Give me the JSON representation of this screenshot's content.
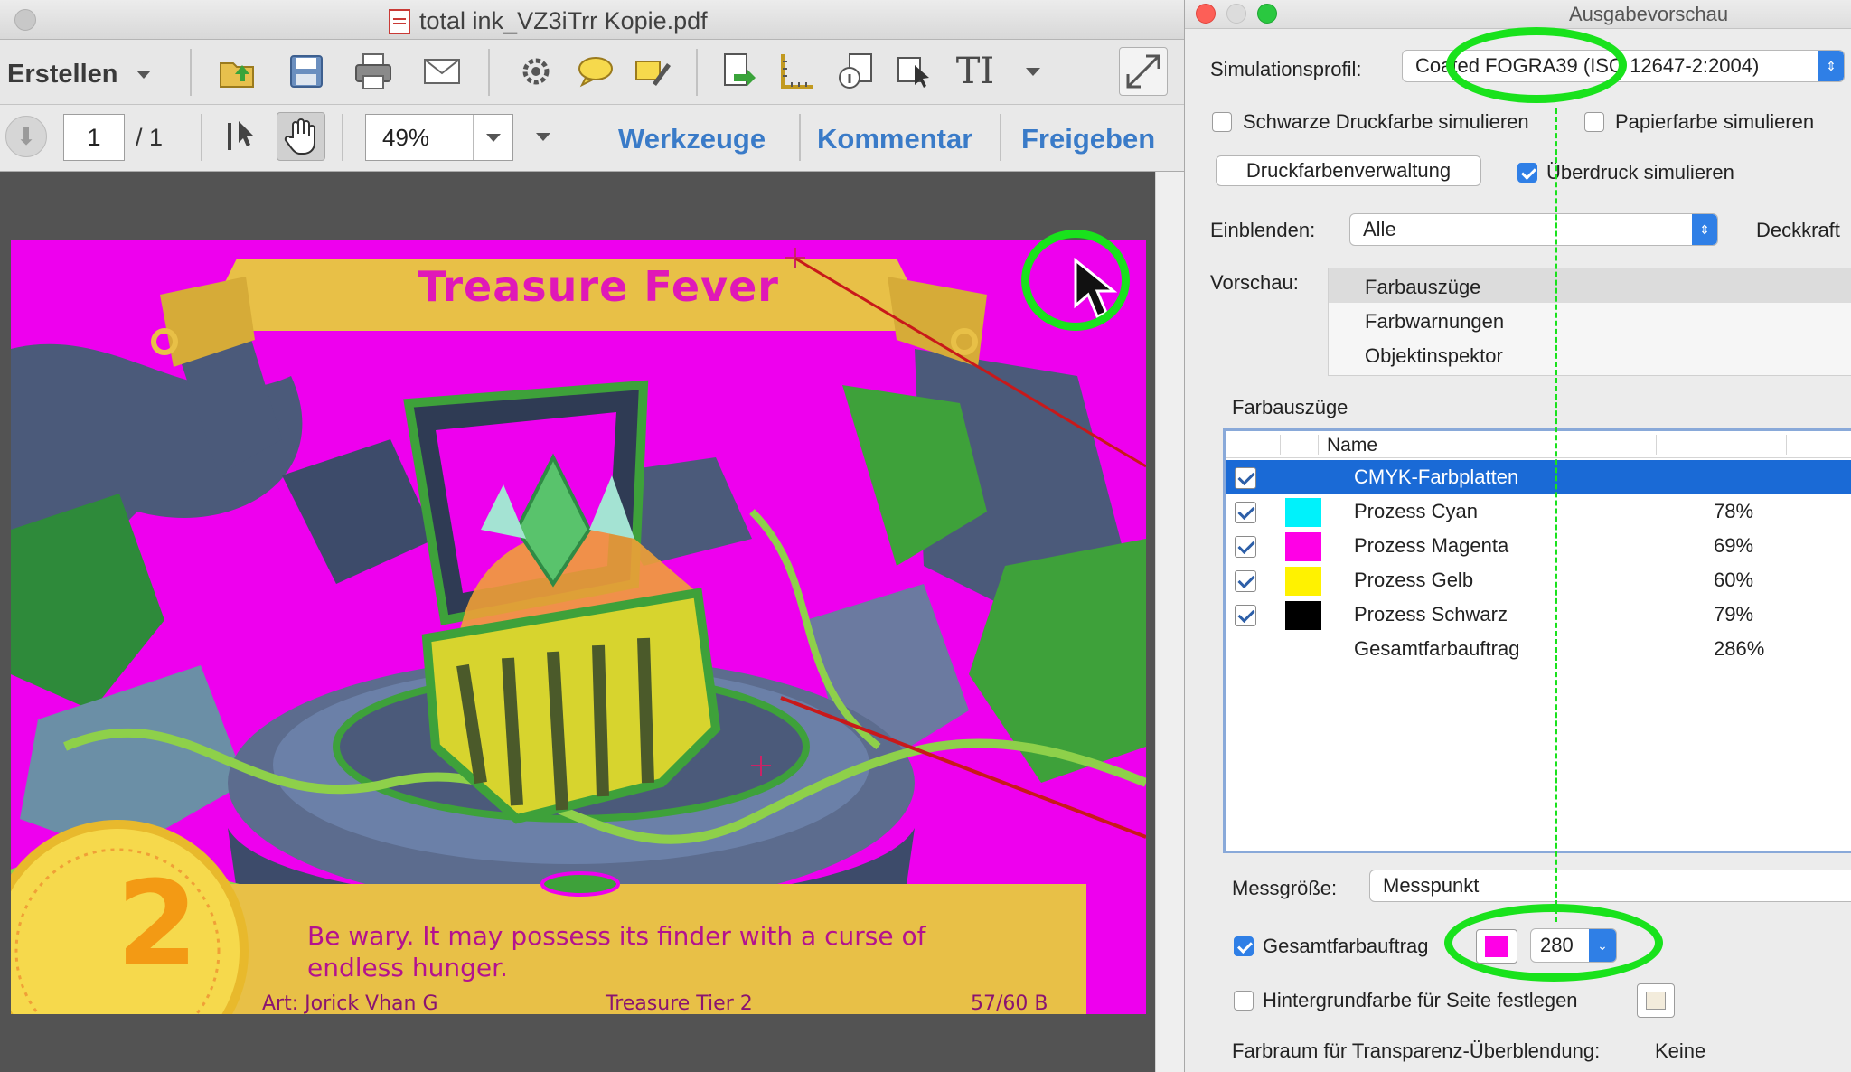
{
  "acrobat": {
    "window_title": "total ink_VZ3iTrr Kopie.pdf",
    "toolbar": {
      "create_label": "Erstellen",
      "icons": [
        "open-icon",
        "save-icon",
        "print-icon",
        "email-icon",
        "settings-icon",
        "comment-icon",
        "highlight-icon",
        "export-icon",
        "measure-icon",
        "info-icon",
        "select-icon",
        "text-tool-icon",
        "more-icon",
        "fullscreen-icon"
      ]
    },
    "nav": {
      "page_current": "1",
      "page_total": "/ 1",
      "zoom": "49%",
      "tools_label": "Werkzeuge",
      "comment_label": "Kommentar",
      "share_label": "Freigeben"
    },
    "card": {
      "title": "Treasure Fever",
      "coin_value": "2",
      "flavor_text": "Be wary. It may possess its finder with a curse of endless hunger.",
      "artist": "Art: Jorick Vhan G",
      "tier": "Treasure Tier 2",
      "number": "57/60 B",
      "colors": {
        "magenta": "#ee00ee",
        "gold": "#e8c047",
        "green": "#3ea13a",
        "slate": "#4b5a7a"
      }
    }
  },
  "preview": {
    "window_title": "Ausgabevorschau",
    "simulation_label": "Simulationsprofil:",
    "simulation_value": "Coated FOGRA39 (ISO 12647-2:2004)",
    "simulate_black_label": "Schwarze Druckfarbe simulieren",
    "simulate_paper_label": "Papierfarbe simulieren",
    "ink_manager_label": "Druckfarbenverwaltung",
    "simulate_overprint_label": "Überdruck simulieren",
    "show_label": "Einblenden:",
    "show_value": "Alle",
    "opacity_label": "Deckkraft",
    "preview_label": "Vorschau:",
    "preview_items": [
      "Farbauszüge",
      "Farbwarnungen",
      "Objektinspektor"
    ],
    "separations_label": "Farbauszüge",
    "name_header": "Name",
    "separations": [
      {
        "name": "CMYK-Farbplatten",
        "percent": "",
        "color": ""
      },
      {
        "name": "Prozess Cyan",
        "percent": "78%",
        "color": "#00f2fb"
      },
      {
        "name": "Prozess Magenta",
        "percent": "69%",
        "color": "#ff00e6"
      },
      {
        "name": "Prozess Gelb",
        "percent": "60%",
        "color": "#fff200"
      },
      {
        "name": "Prozess Schwarz",
        "percent": "79%",
        "color": "#000000"
      },
      {
        "name": "Gesamtfarbauftrag",
        "percent": "286%",
        "color": ""
      }
    ],
    "sample_size_label": "Messgröße:",
    "sample_size_value": "Messpunkt",
    "total_coverage_label": "Gesamtfarbauftrag",
    "total_coverage_value": "280",
    "total_coverage_color": "#ff00e6",
    "bg_color_label": "Hintergrundfarbe für Seite festlegen",
    "blend_space_label": "Farbraum für Transparenz-Überblendung:",
    "blend_space_value": "Keine"
  }
}
